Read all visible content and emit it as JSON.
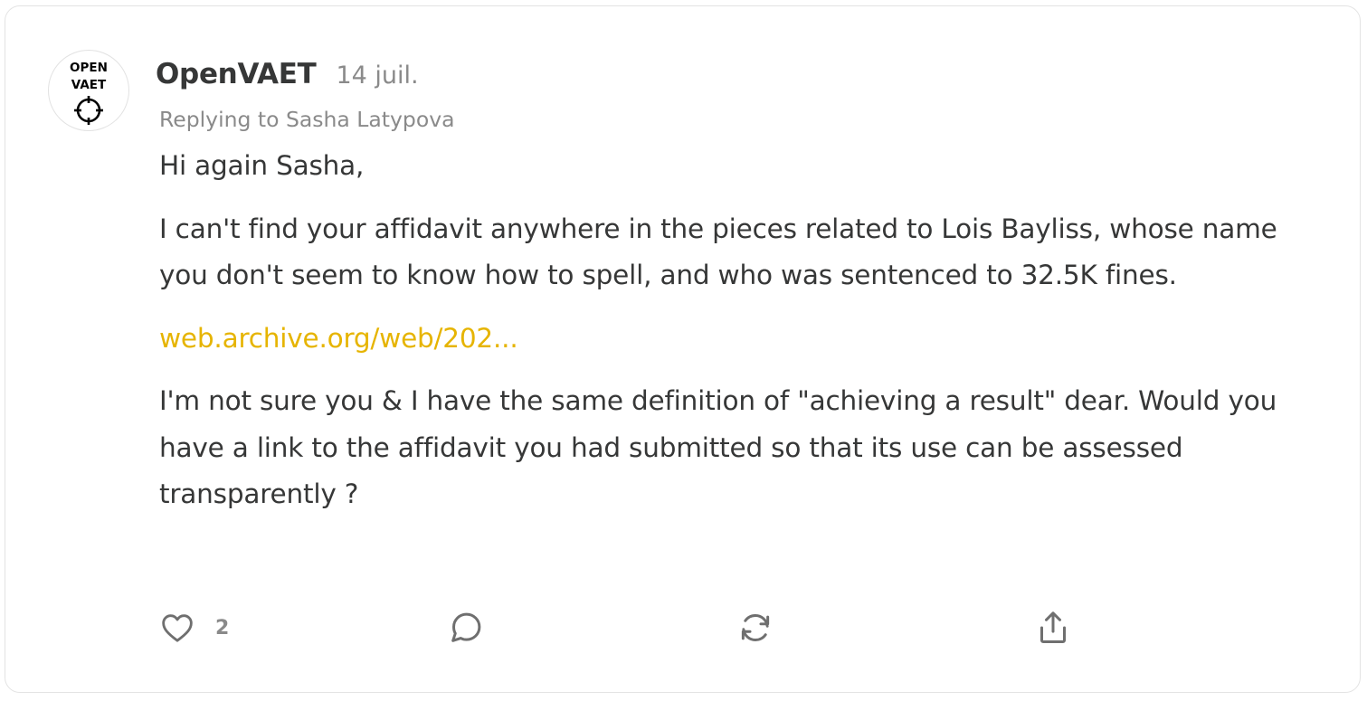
{
  "comment": {
    "avatar": {
      "icon": "crosshair-icon",
      "line1": "OPEN",
      "line2": "VAET"
    },
    "author": "OpenVAET",
    "date": "14 juil.",
    "replying_to": "Replying to Sasha Latypova",
    "paragraphs": [
      "Hi again Sasha,",
      "I can't find your affidavit anywhere in the pieces related to Lois Bayliss, whose name you don't seem to know how to spell, and who was sentenced to 32.5K fines.",
      "I'm not sure you & I have the same definition of \"achieving a result\" dear. Would you have a link to the affidavit you had submitted so that its use can be assessed transparently ?"
    ],
    "link_text": "web.archive.org/web/202...",
    "link_color": "#e6b400",
    "actions": {
      "like_icon": "heart-icon",
      "like_count": "2",
      "reply_icon": "comment-bubble-icon",
      "restack_icon": "refresh-icon",
      "share_icon": "share-icon"
    }
  }
}
